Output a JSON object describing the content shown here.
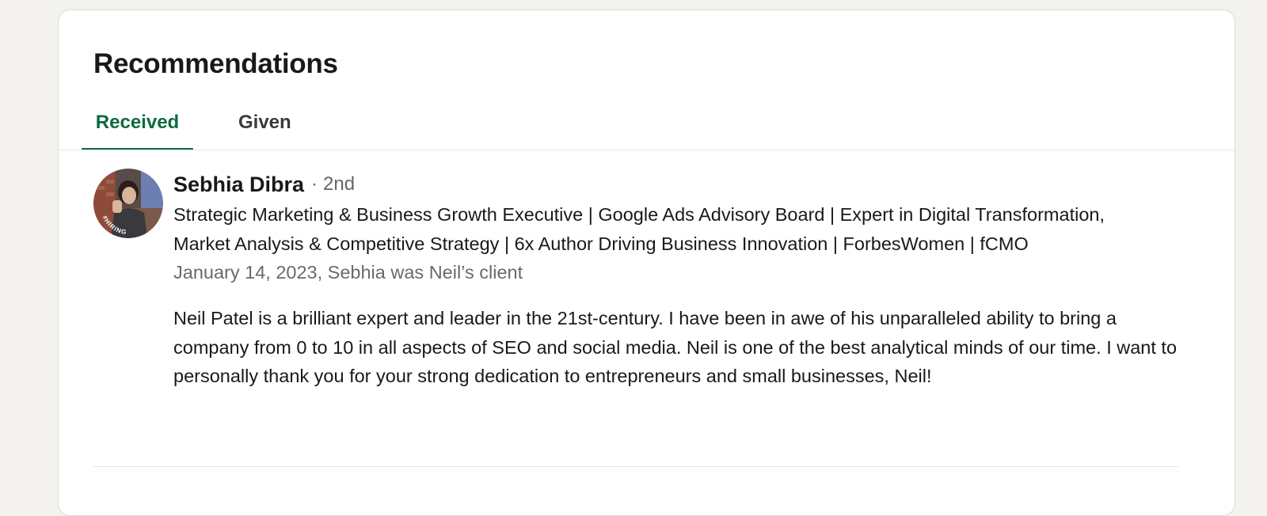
{
  "section": {
    "title": "Recommendations",
    "tabs": [
      {
        "label": "Received",
        "active": true
      },
      {
        "label": "Given",
        "active": false
      }
    ],
    "accent_color": "#0d6b3e"
  },
  "recommendation": {
    "avatar_badge": "#HIRING",
    "name": "Sebhia Dibra",
    "separator": "·",
    "degree": "2nd",
    "headline": "Strategic Marketing & Business Growth Executive | Google Ads Advisory Board | Expert in Digital Transformation, Market Analysis & Competitive Strategy | 6x Author Driving Business Innovation | ForbesWomen | fCMO",
    "meta": "January 14, 2023, Sebhia was Neil’s client",
    "text": "Neil Patel is a brilliant expert and leader in the 21st-century. I have been in awe of his unparalleled ability to bring a company from 0 to 10 in all aspects of SEO and social media. Neil is one of the best analytical minds of our time. I want to personally thank you for your strong dedication to entrepreneurs and small businesses, Neil!"
  }
}
